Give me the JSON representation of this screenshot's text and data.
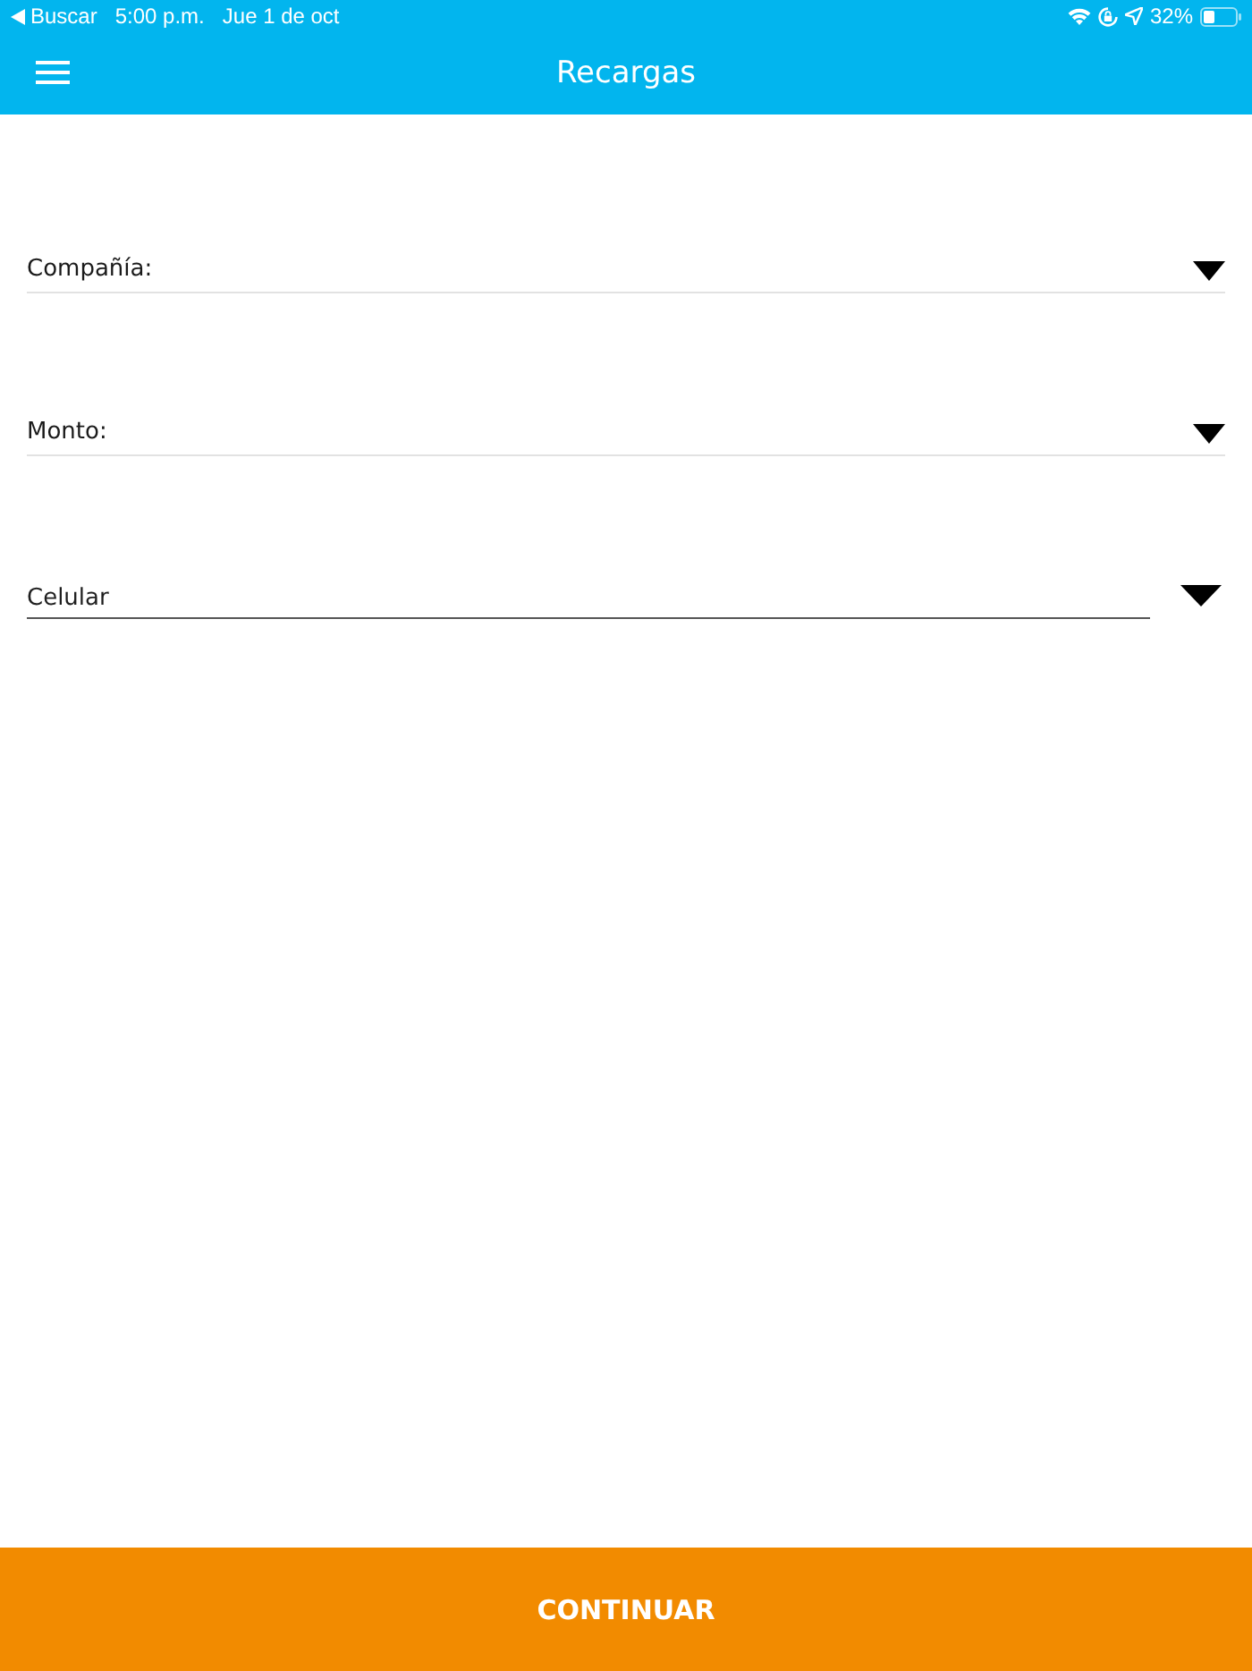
{
  "status_bar": {
    "back_label": "Buscar",
    "time": "5:00 p.m.",
    "date": "Jue 1 de oct",
    "battery": "32%"
  },
  "header": {
    "title": "Recargas"
  },
  "fields": [
    {
      "kind": "select",
      "label": "Compañía:"
    },
    {
      "kind": "select",
      "label": "Monto:"
    },
    {
      "kind": "input",
      "placeholder": "Celular"
    }
  ],
  "button": {
    "label": "CONTINUAR"
  }
}
